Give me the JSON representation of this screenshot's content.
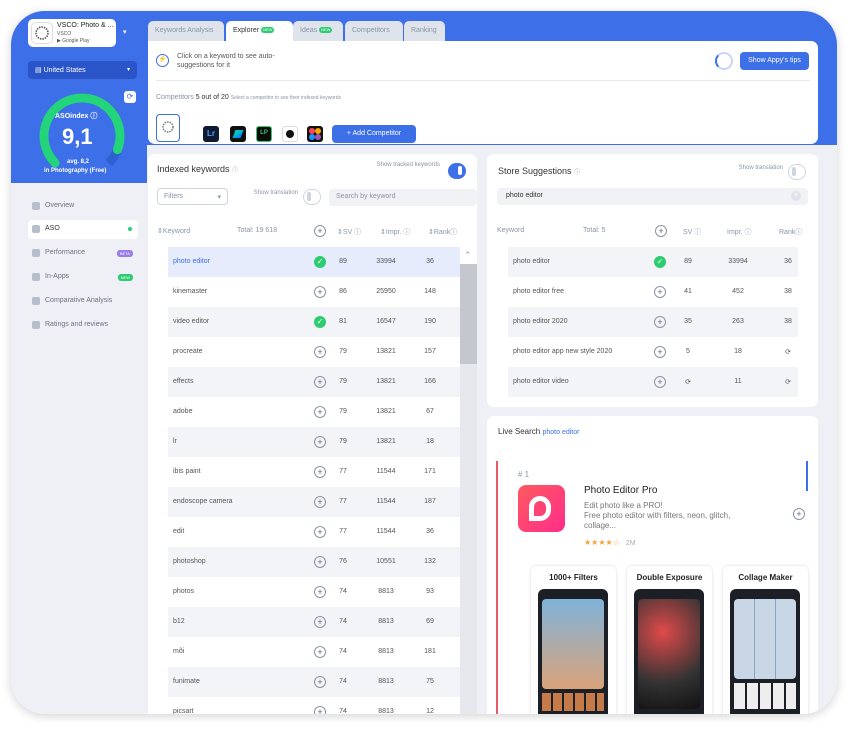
{
  "app": {
    "name": "VSCO: Photo & ...",
    "developer": "VSCO",
    "store": "Google Play"
  },
  "country": "United States",
  "aso": {
    "label": "ASOindex",
    "value": "9,1",
    "avg": "avg. 8,2",
    "category": "in Photography (Free)",
    "score_fraction": 0.91
  },
  "nav": [
    {
      "label": "Overview"
    },
    {
      "label": "ASO"
    },
    {
      "label": "Performance",
      "badge": "BETA"
    },
    {
      "label": "In-Apps",
      "badge": "NEW"
    },
    {
      "label": "Comparative Analysis"
    },
    {
      "label": "Ratings and reviews"
    }
  ],
  "tabs": [
    {
      "label": "Keywords Analysis"
    },
    {
      "label": "Explorer",
      "badge": "NEW"
    },
    {
      "label": "Ideas",
      "badge": "NEW"
    },
    {
      "label": "Competitors"
    },
    {
      "label": "Ranking"
    }
  ],
  "tip": {
    "text": "Click on a keyword to see auto-suggestions for it",
    "button": "Show Appy's tips"
  },
  "competitors": {
    "label": "Competitors",
    "count": "5 out of 20",
    "hint": "Select a competitor to see their indexed keywords",
    "add_button": "+ Add Competitor"
  },
  "indexed": {
    "title": "Indexed keywords",
    "toggle_label": "Show tracked keywords",
    "filters_placeholder": "Filters",
    "translation_label": "Show translation",
    "search_placeholder": "Search by keyword",
    "col_keyword": "Keyword",
    "total": "Total: 19 618",
    "col_sv": "SV",
    "col_impr": "Impr.",
    "col_rank": "Rank",
    "rows": [
      {
        "keyword": "photo editor",
        "sv": "89",
        "impr": "33994",
        "rank": "36",
        "tracked": true
      },
      {
        "keyword": "kinemaster",
        "sv": "86",
        "impr": "25950",
        "rank": "148",
        "tracked": false
      },
      {
        "keyword": "video editor",
        "sv": "81",
        "impr": "16547",
        "rank": "190",
        "tracked": true
      },
      {
        "keyword": "procreate",
        "sv": "79",
        "impr": "13821",
        "rank": "157",
        "tracked": false
      },
      {
        "keyword": "effects",
        "sv": "79",
        "impr": "13821",
        "rank": "166",
        "tracked": false
      },
      {
        "keyword": "adobe",
        "sv": "79",
        "impr": "13821",
        "rank": "67",
        "tracked": false
      },
      {
        "keyword": "lr",
        "sv": "79",
        "impr": "13821",
        "rank": "18",
        "tracked": false
      },
      {
        "keyword": "ibis paint",
        "sv": "77",
        "impr": "11544",
        "rank": "171",
        "tracked": false
      },
      {
        "keyword": "endoscope camera",
        "sv": "77",
        "impr": "11544",
        "rank": "187",
        "tracked": false
      },
      {
        "keyword": "edit",
        "sv": "77",
        "impr": "11544",
        "rank": "36",
        "tracked": false
      },
      {
        "keyword": "photoshop",
        "sv": "76",
        "impr": "10551",
        "rank": "132",
        "tracked": false
      },
      {
        "keyword": "photos",
        "sv": "74",
        "impr": "8813",
        "rank": "93",
        "tracked": false
      },
      {
        "keyword": "b12",
        "sv": "74",
        "impr": "8813",
        "rank": "69",
        "tracked": false
      },
      {
        "keyword": "mõi",
        "sv": "74",
        "impr": "8813",
        "rank": "181",
        "tracked": false
      },
      {
        "keyword": "funimate",
        "sv": "74",
        "impr": "8813",
        "rank": "75",
        "tracked": false
      },
      {
        "keyword": "picsart",
        "sv": "74",
        "impr": "8813",
        "rank": "12",
        "tracked": false
      }
    ]
  },
  "suggestions": {
    "title": "Store Suggestions",
    "translation_label": "Show translation",
    "search_value": "photo editor",
    "col_keyword": "Keyword",
    "total": "Total: 5",
    "col_sv": "SV",
    "col_impr": "Impr.",
    "col_rank": "Rank",
    "rows": [
      {
        "keyword": "photo editor",
        "sv": "89",
        "impr": "33994",
        "rank": "36",
        "tracked": true
      },
      {
        "keyword": "photo editor free",
        "sv": "41",
        "impr": "452",
        "rank": "38",
        "tracked": false
      },
      {
        "keyword": "photo editor 2020",
        "sv": "35",
        "impr": "263",
        "rank": "38",
        "tracked": false
      },
      {
        "keyword": "photo editor app new style 2020",
        "sv": "5",
        "impr": "18",
        "rank": "",
        "tracked": false
      },
      {
        "keyword": "photo editor video",
        "sv": "",
        "impr": "11",
        "rank": "",
        "tracked": false
      }
    ]
  },
  "live": {
    "title": "Live Search",
    "keyword": "photo editor",
    "position": "# 1",
    "app_name": "Photo Editor Pro",
    "desc1": "Edit photo like a PRO!",
    "desc2": "Free photo editor with filters, neon, glitch,",
    "desc3": "collage...",
    "installs": "2M",
    "shots": [
      {
        "title": "1000+ Filters"
      },
      {
        "title": "Double Exposure"
      },
      {
        "title": "Collage Maker"
      }
    ]
  },
  "colors": {
    "accent": "#3d6fe8",
    "green": "#2ecc71",
    "live_bar": "#e85a6a"
  }
}
